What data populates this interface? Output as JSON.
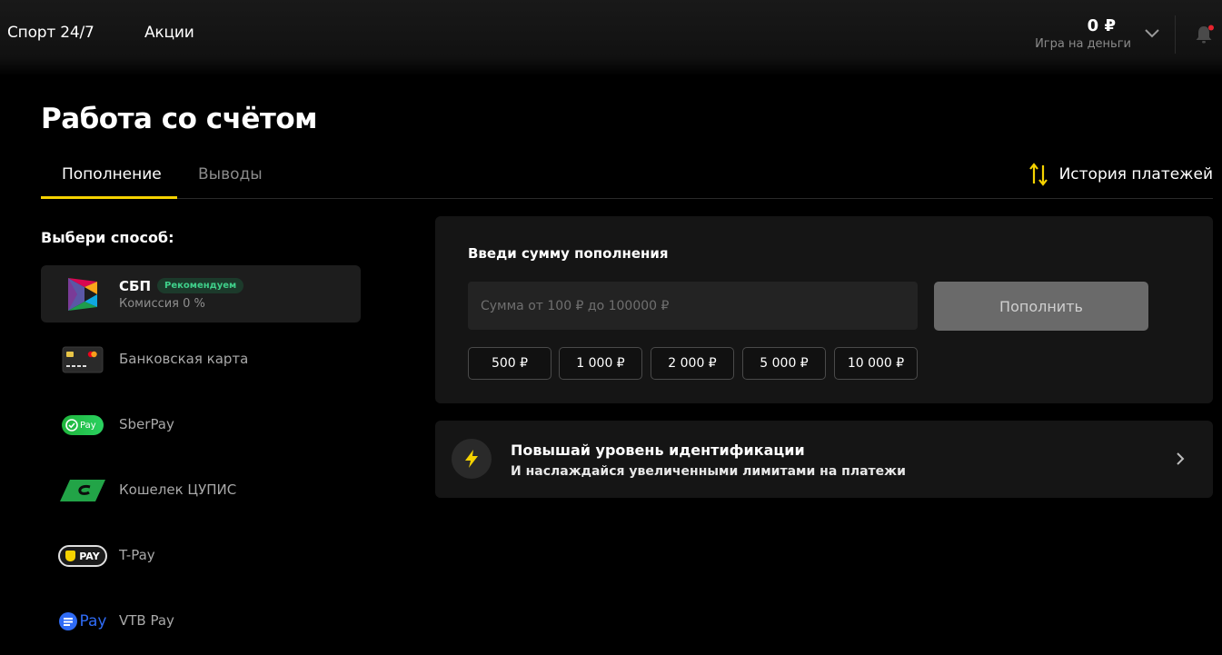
{
  "header": {
    "nav": [
      "Спорт 24/7",
      "Акции"
    ],
    "balance_amount": "0 ₽",
    "balance_label": "Игра на деньги"
  },
  "page": {
    "title": "Работа со счётом",
    "tabs": [
      "Пополнение",
      "Выводы"
    ],
    "history_label": "История платежей"
  },
  "methods": {
    "title": "Выбери способ:",
    "items": [
      {
        "label": "СБП",
        "badge": "Рекомендуем",
        "sub": "Комиссия 0 %",
        "icon": "sbp-logo-icon"
      },
      {
        "label": "Банковская карта",
        "icon": "bank-card-icon"
      },
      {
        "label": "SberPay",
        "icon": "sberpay-logo-icon",
        "logo_text": "Pay"
      },
      {
        "label": "Кошелек ЦУПИС",
        "icon": "cupis-logo-icon"
      },
      {
        "label": "T-Pay",
        "icon": "tpay-logo-icon",
        "logo_text": "PAY"
      },
      {
        "label": "VTB Pay",
        "icon": "vtbpay-logo-icon",
        "logo_text": "Pay"
      }
    ]
  },
  "deposit": {
    "title": "Введи сумму пополнения",
    "input_placeholder": "Сумма от 100 ₽ до 100000 ₽",
    "submit_label": "Пополнить",
    "presets": [
      "500 ₽",
      "1 000 ₽",
      "2 000 ₽",
      "5 000 ₽",
      "10 000 ₽"
    ]
  },
  "identification": {
    "title": "Повышай уровень идентификации",
    "subtitle": "И наслаждайся увеличенными лимитами на платежи"
  },
  "colors": {
    "accent": "#f5d200",
    "badge_text": "#3fd08a",
    "notification_dot": "#e8232d"
  }
}
